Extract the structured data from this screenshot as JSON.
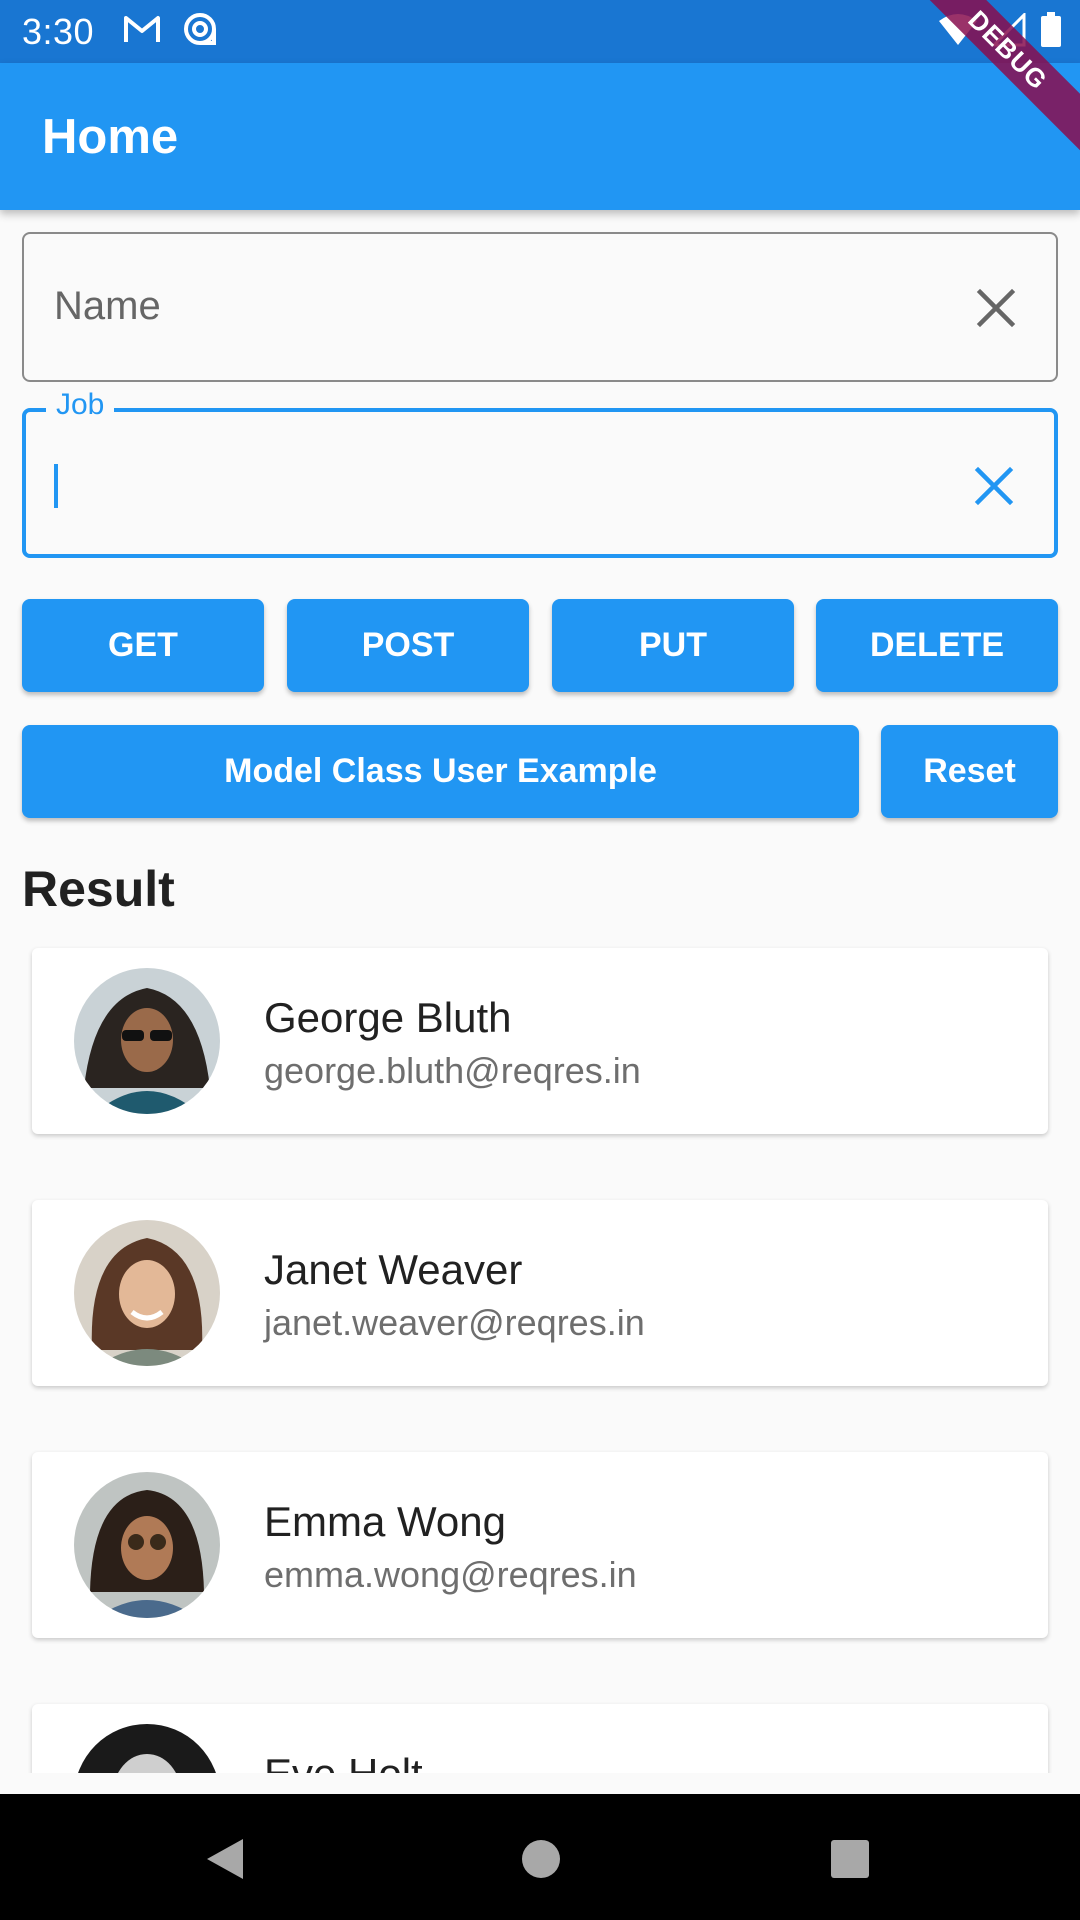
{
  "status_bar": {
    "time": "3:30",
    "left_icons": [
      "gmail-icon",
      "sync-icon"
    ],
    "right_icons": [
      "wifi-icon",
      "signal-icon",
      "battery-icon"
    ]
  },
  "debug_banner": "DEBUG",
  "app_bar": {
    "title": "Home"
  },
  "form": {
    "name_field": {
      "placeholder": "Name",
      "value": ""
    },
    "job_field": {
      "label": "Job",
      "value": ""
    }
  },
  "buttons": {
    "get": "GET",
    "post": "POST",
    "put": "PUT",
    "delete": "DELETE",
    "model": "Model Class User Example",
    "reset": "Reset"
  },
  "result": {
    "heading": "Result",
    "users": [
      {
        "name": "George Bluth",
        "email": "george.bluth@reqres.in"
      },
      {
        "name": "Janet Weaver",
        "email": "janet.weaver@reqres.in"
      },
      {
        "name": "Emma Wong",
        "email": "emma.wong@reqres.in"
      },
      {
        "name": "Eve Holt",
        "email": ""
      }
    ]
  },
  "colors": {
    "primary": "#2196f3",
    "status_bar": "#1976d2",
    "debug": "#880e4f"
  },
  "nav_bar": [
    "back-icon",
    "home-icon",
    "recents-icon"
  ]
}
